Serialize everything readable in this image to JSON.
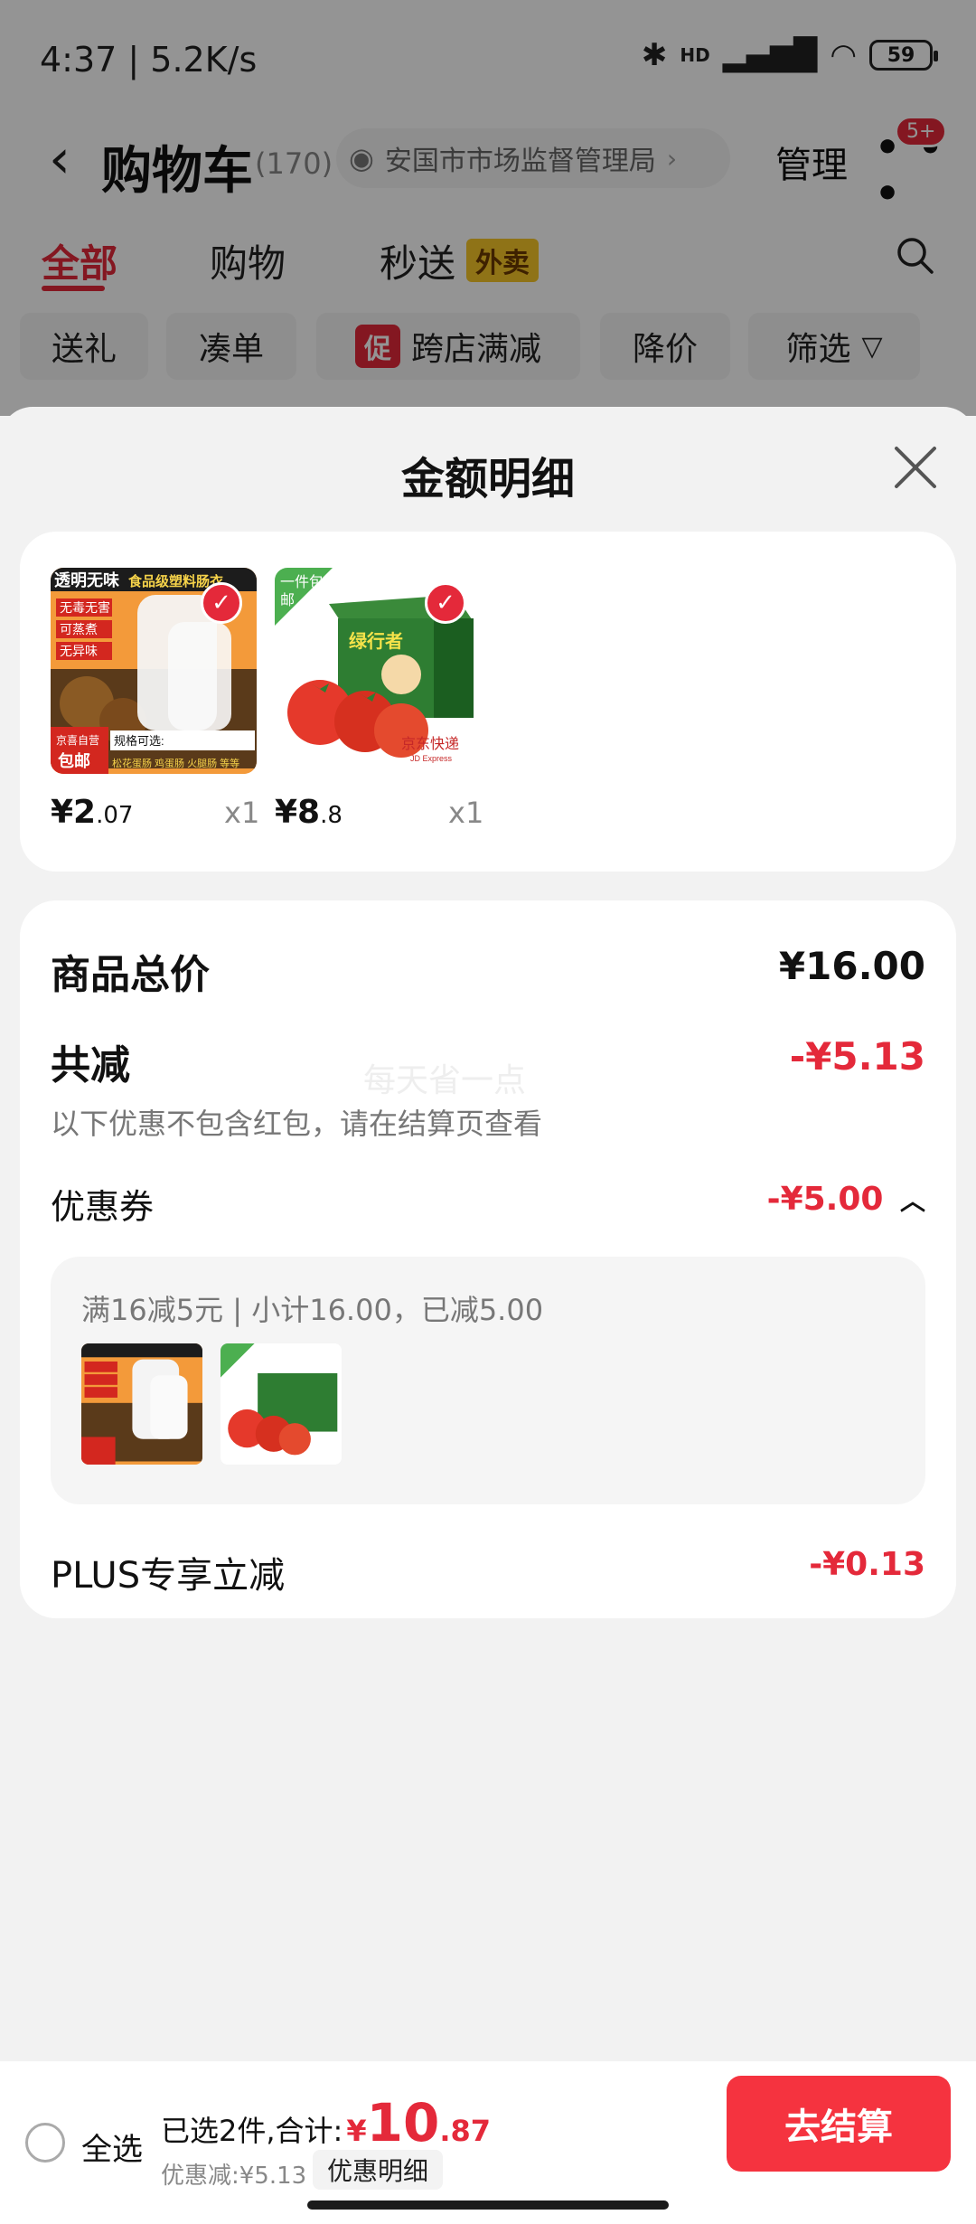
{
  "status_bar": {
    "time": "4:37 | 5.2K/s",
    "battery": "59",
    "signal_label": "HD"
  },
  "nav": {
    "title": "购物车",
    "count": "(170)",
    "location": "安国市市场监督管理局",
    "manage_label": "管理",
    "badge": "5+"
  },
  "tabs": [
    {
      "label": "全部",
      "active": true
    },
    {
      "label": "购物"
    },
    {
      "label": "秒送"
    }
  ],
  "tab_tag": "外卖",
  "chips": [
    "送礼",
    "凑单",
    "跨店满减",
    "降价",
    "筛选"
  ],
  "promo_tag": "促",
  "sheet": {
    "title": "金额明细",
    "products": [
      {
        "price_int": "¥2",
        "price_dec": ".07",
        "qty": "x1",
        "badge": "",
        "img_text": [
          "透明无味",
          "食品级塑料肠衣",
          "无毒无害",
          "可蒸煮",
          "无异味",
          "规格可选:",
          "京喜自营",
          "包邮",
          "松花蛋肠 鸡蛋肠 火腿肠 等等"
        ]
      },
      {
        "price_int": "¥8",
        "price_dec": ".8",
        "qty": "x1",
        "badge": "一件包邮",
        "img_text": [
          "绿行者",
          "京东快递",
          "JD Express"
        ]
      }
    ],
    "summary": {
      "total_label": "商品总价",
      "total_value": "¥16.00",
      "discount_label": "共减",
      "discount_value": "-¥5.13",
      "watermark": "每天省一点",
      "note": "以下优惠不包含红包，请在结算页查看",
      "coupon_label": "优惠券",
      "coupon_value": "-¥5.00",
      "coupon_desc": "满16减5元 | 小计16.00，已减5.00",
      "plus_label": "PLUS专享立减",
      "plus_value": "-¥0.13"
    }
  },
  "bottom_bar": {
    "select_all": "全选",
    "selected_text": "已选2件,合计:",
    "total_symbol": "¥",
    "total_int": "10",
    "total_dec": ".87",
    "saving_text": "优惠减:¥5.13",
    "detail_label": "优惠明细",
    "checkout_label": "去结算"
  },
  "colors": {
    "accent": "#e4293a",
    "checkout": "#f5333f",
    "sheet_bg": "#f2f2f2"
  }
}
